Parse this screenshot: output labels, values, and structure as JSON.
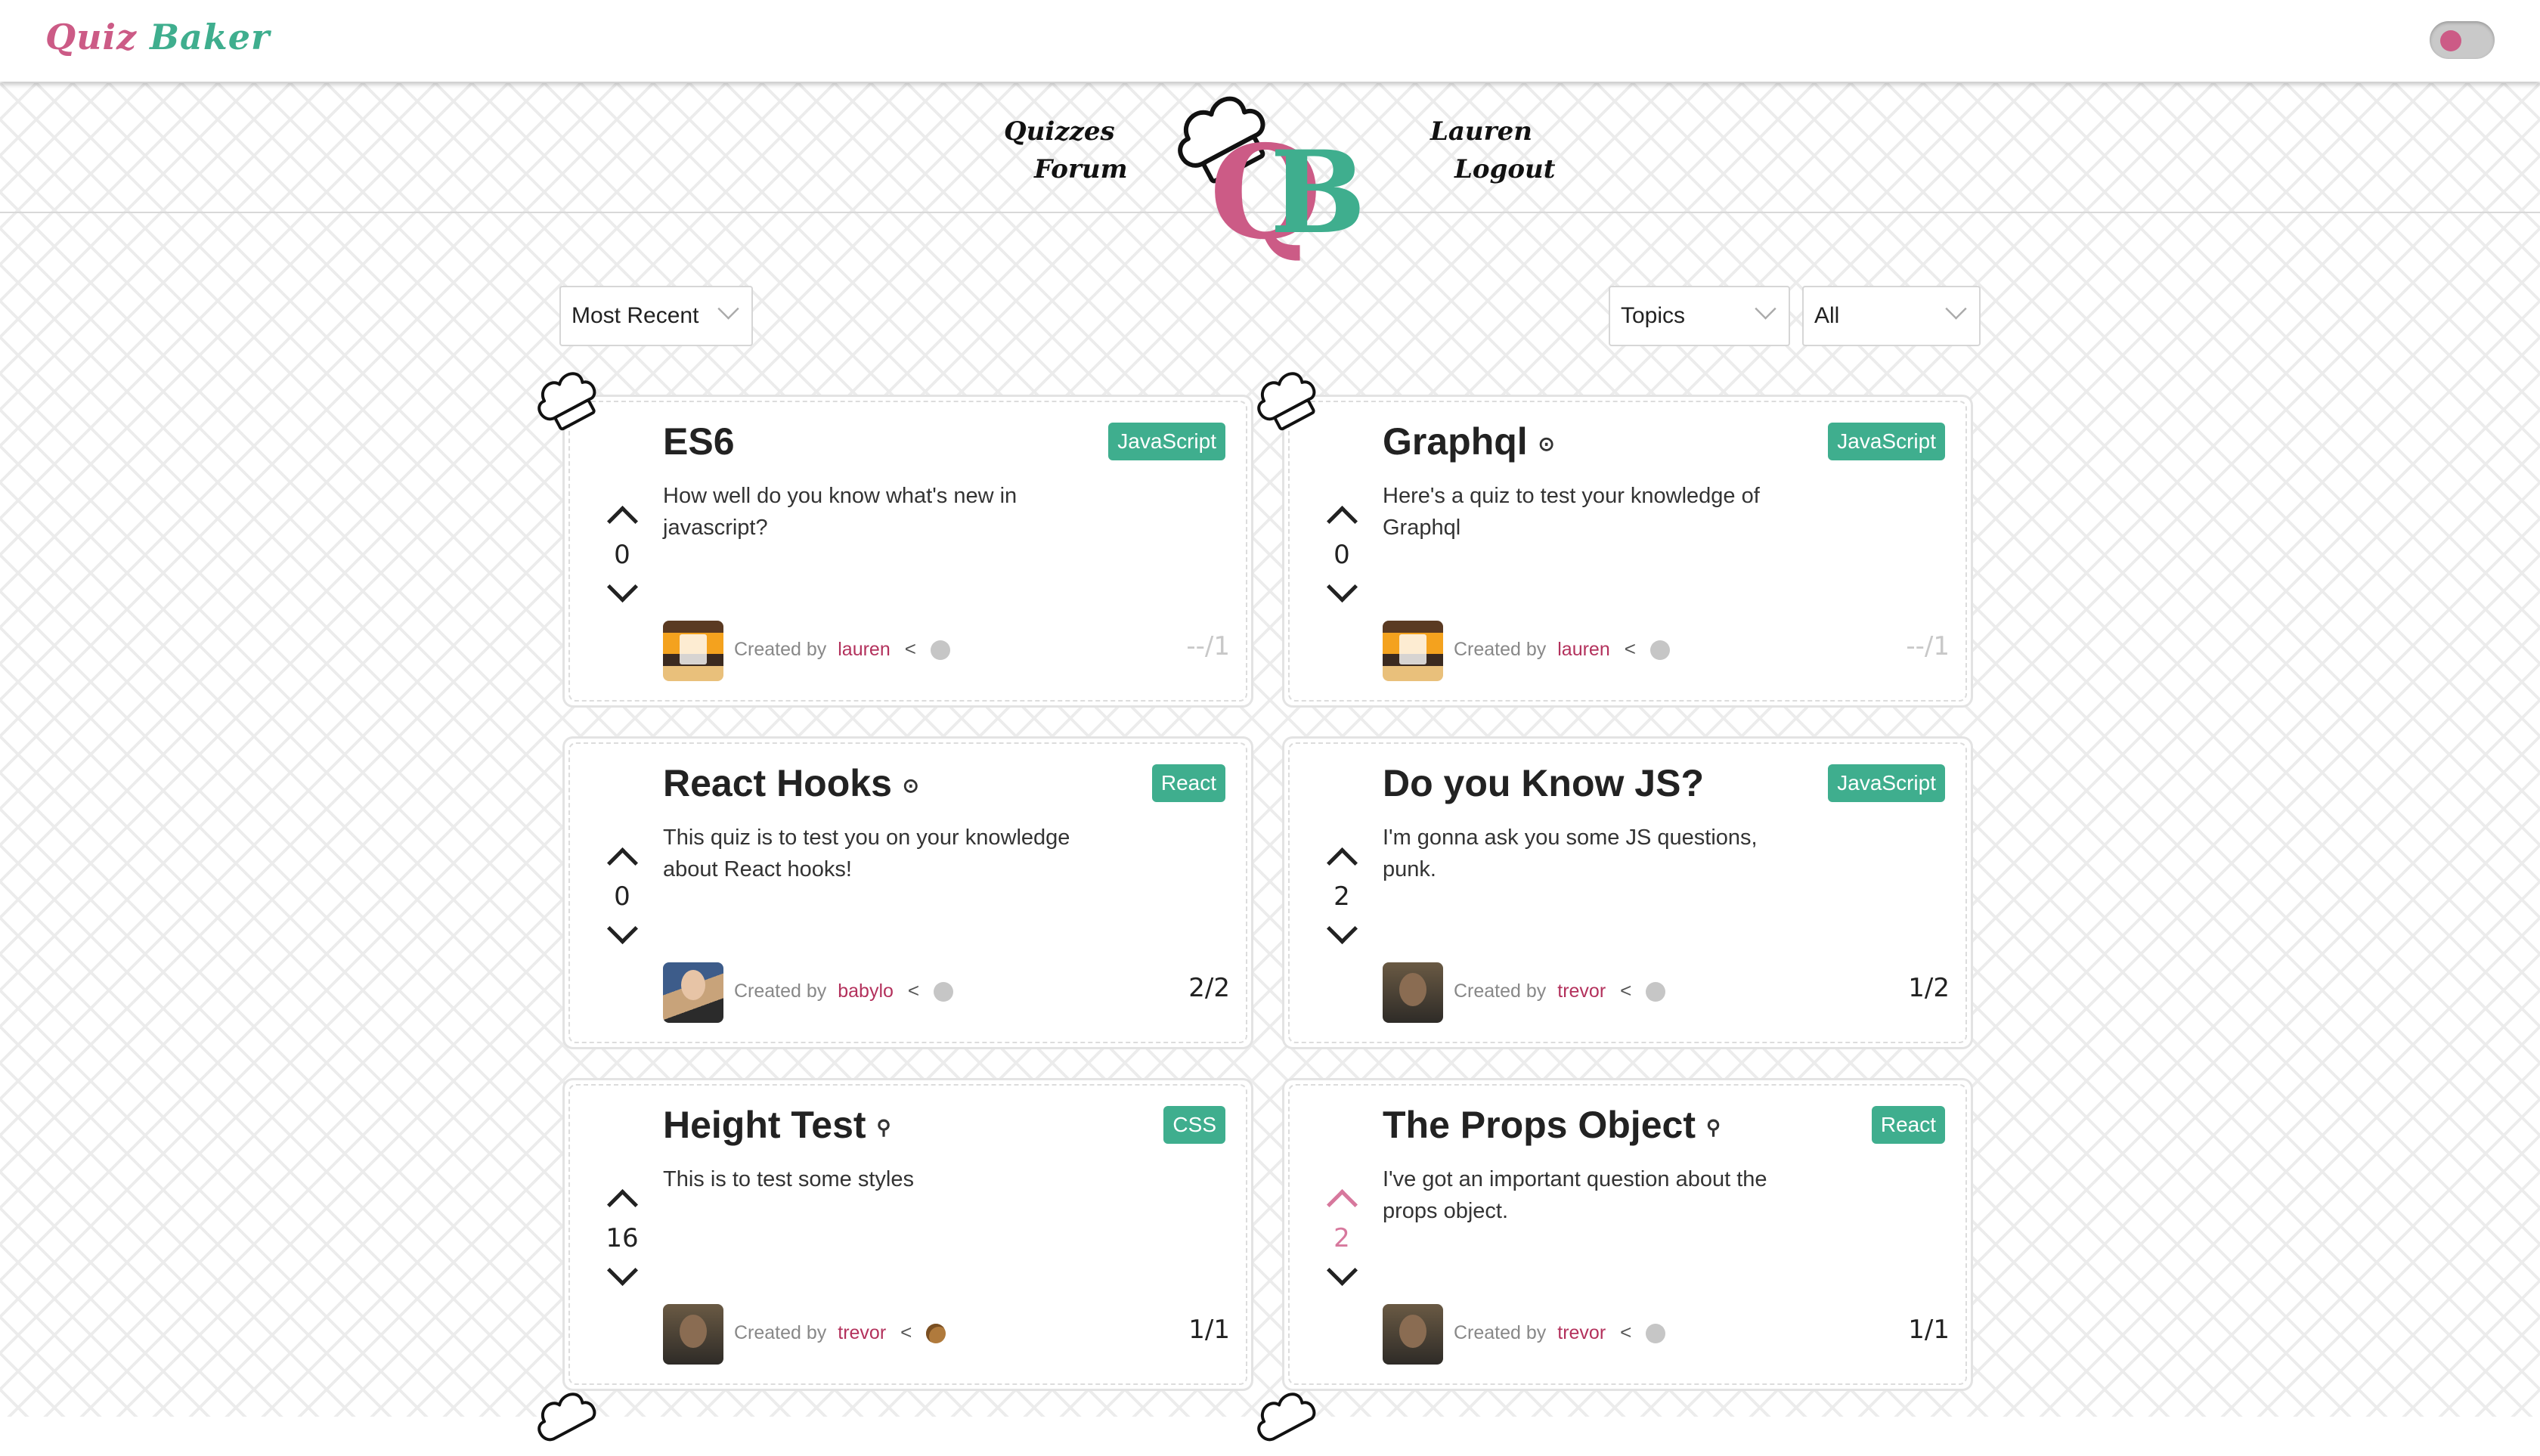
{
  "app": {
    "brand_quiz": "Quiz",
    "brand_baker": "Baker",
    "logo_q": "Q",
    "logo_b": "B"
  },
  "nav": {
    "quizzes": "Quizzes",
    "forum": "Forum",
    "user": "Lauren",
    "logout": "Logout"
  },
  "filters": {
    "sort": "Most Recent",
    "topics": "Topics",
    "scope": "All"
  },
  "colors": {
    "brand_pink": "#cc5b86",
    "brand_green": "#3fae8e",
    "tag_bg": "#3fae8e",
    "username": "#b3315c"
  },
  "cards": [
    {
      "title": "ES6",
      "status_icon": "",
      "tag": "JavaScript",
      "description": "How well do you know what's new in javascript?",
      "votes": "0",
      "creator_prefix": "Created by",
      "creator": "lauren",
      "score": "--/1",
      "badge": "medal-icon"
    },
    {
      "title": "Graphql",
      "status_icon": "⊙",
      "tag": "JavaScript",
      "description": "Here's a quiz to test your knowledge of Graphql",
      "votes": "0",
      "creator_prefix": "Created by",
      "creator": "lauren",
      "score": "--/1",
      "badge": "medal-icon"
    },
    {
      "title": "React Hooks",
      "status_icon": "⊙",
      "tag": "React",
      "description": "This quiz is to test you on your knowledge about React hooks!",
      "votes": "0",
      "creator_prefix": "Created by",
      "creator": "babylo",
      "score": "2/2",
      "badge": "medal-icon"
    },
    {
      "title": "Do you Know JS?",
      "status_icon": "",
      "tag": "JavaScript",
      "description": "I'm gonna ask you some JS questions, punk.",
      "votes": "2",
      "creator_prefix": "Created by",
      "creator": "trevor",
      "score": "1/2",
      "badge": "medal-icon"
    },
    {
      "title": "Height Test",
      "status_icon": "⚲",
      "tag": "CSS",
      "description": "This is to test some styles",
      "votes": "16",
      "creator_prefix": "Created by",
      "creator": "trevor",
      "score": "1/1",
      "badge": "cookie-icon"
    },
    {
      "title": "The Props Object",
      "status_icon": "⚲",
      "tag": "React",
      "description": "I've got an important question about the props object.",
      "votes": "2",
      "creator_prefix": "Created by",
      "creator": "trevor",
      "score": "1/1",
      "badge": "medal-icon"
    }
  ]
}
